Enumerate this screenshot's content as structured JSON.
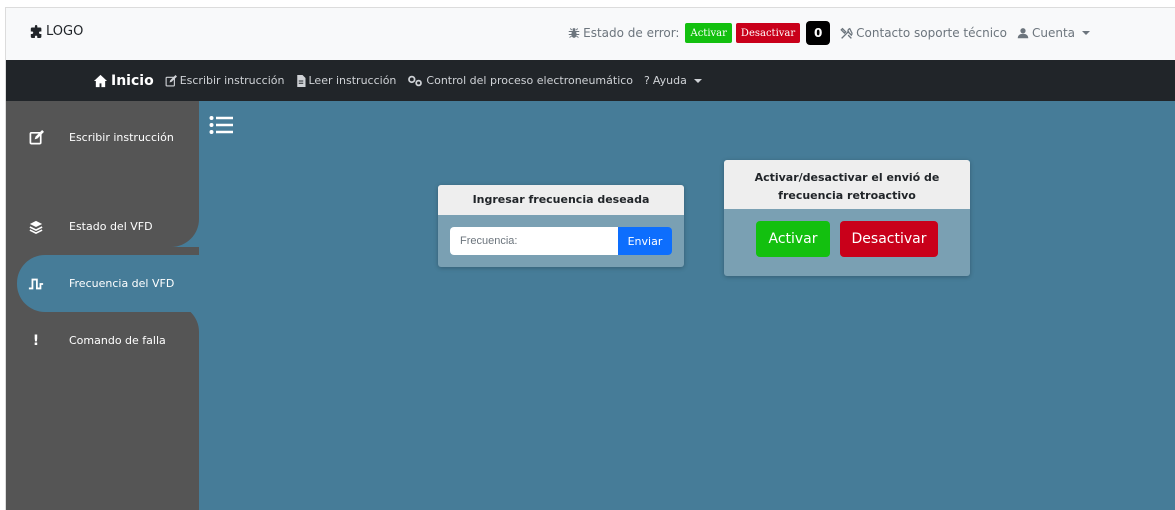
{
  "header": {
    "logo_text": "LOGO",
    "error_state_label": "Estado de error:",
    "activate_label": "Activar",
    "deactivate_label": "Desactivar",
    "error_count": "0",
    "support_label": "Contacto soporte técnico",
    "account_label": "Cuenta"
  },
  "nav": {
    "home": "Inicio",
    "write": "Escribir instrucción",
    "read": "Leer instrucción",
    "control": "Control del proceso electroneumático",
    "help": "Ayuda"
  },
  "sidebar": {
    "items": [
      {
        "label": "Escribir instrucción",
        "icon": "edit-icon"
      },
      {
        "label": "Estado del VFD",
        "icon": "layers-icon"
      },
      {
        "label": "Frecuencia del VFD",
        "icon": "pulse-icon",
        "active": true
      },
      {
        "label": "Comando de falla",
        "icon": "exclamation-icon"
      }
    ]
  },
  "frequency_card": {
    "title": "Ingresar frecuencia deseada",
    "placeholder": "Frecuencia:",
    "value": "",
    "send_label": "Enviar"
  },
  "retro_card": {
    "title_line1": "Activar/desactivar el envió de",
    "title_line2": "frecuencia retroactivo",
    "activate_label": "Activar",
    "deactivate_label": "Desactivar"
  },
  "colors": {
    "main_bg": "#467c98",
    "sidebar_bg": "#555555",
    "navbar_bg": "#212529",
    "green": "#13c00f",
    "red": "#c9001a",
    "primary": "#0d6efd"
  }
}
